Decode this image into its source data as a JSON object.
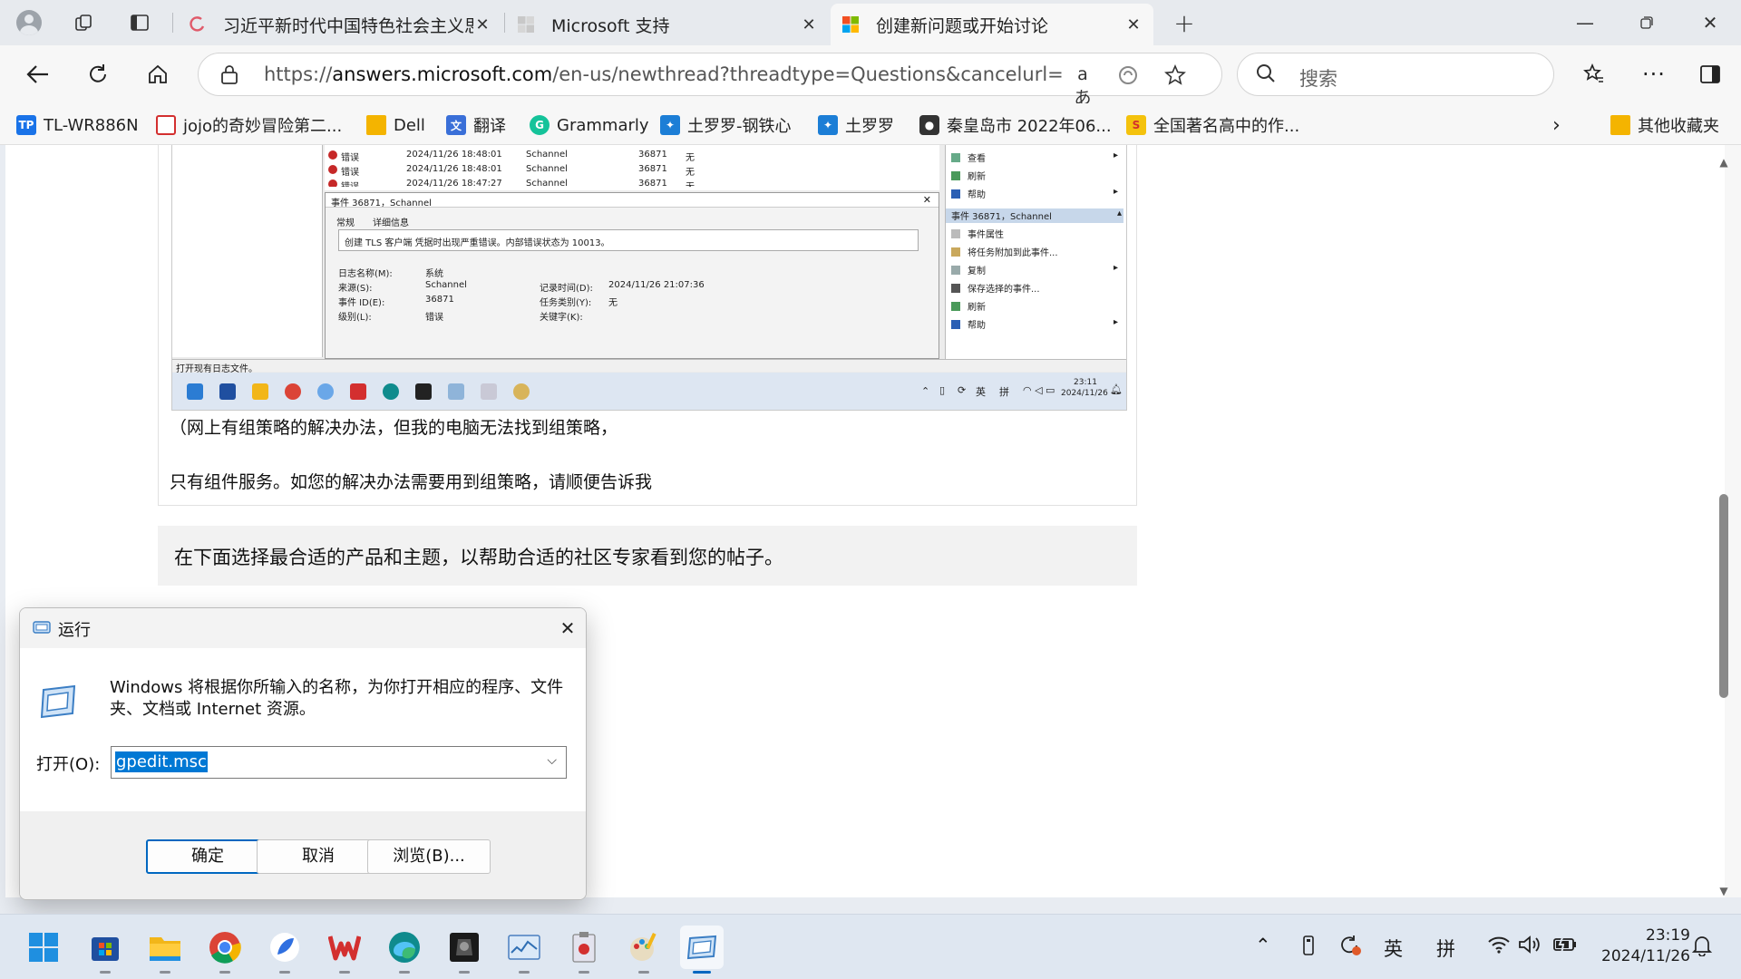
{
  "browser": {
    "tabs": [
      {
        "title": "习近平新时代中国特色社会主义思",
        "favicon": "spiral-icon",
        "active": false
      },
      {
        "title": "Microsoft 支持",
        "favicon": "microsoft-logo-icon",
        "active": false
      },
      {
        "title": "创建新问题或开始讨论",
        "favicon": "microsoft-logo-icon",
        "active": true
      }
    ],
    "url_prefix": "https://",
    "url_host": "answers.microsoft.com",
    "url_rest": "/en-us/newthread?threadtype=Questions&cancelurl=https%...",
    "read_aloud_label": "aあ",
    "search_placeholder": "搜索",
    "favorites": [
      {
        "label": "TL-WR886N",
        "icon": "tplink-icon",
        "icon_text": "TP",
        "color": "#1a73e8"
      },
      {
        "label": "jojo的奇妙冒险第二...",
        "icon": "bookmark-icon",
        "icon_text": "",
        "color": "#d32f2f"
      },
      {
        "label": "Dell",
        "icon": "folder-icon",
        "icon_text": "",
        "color": "#f4b400"
      },
      {
        "label": "翻译",
        "icon": "translate-icon",
        "icon_text": "",
        "color": "#3a6fd8"
      },
      {
        "label": "Grammarly",
        "icon": "grammarly-icon",
        "icon_text": "G",
        "color": "#15c39a"
      },
      {
        "label": "土罗罗-钢铁心",
        "icon": "game-icon",
        "icon_text": "",
        "color": "#1c7ed6"
      },
      {
        "label": "土罗罗",
        "icon": "game-icon",
        "icon_text": "",
        "color": "#1c7ed6"
      },
      {
        "label": "秦皇岛市 2022年06...",
        "icon": "video-icon",
        "icon_text": "",
        "color": "#333333"
      },
      {
        "label": "全国著名高中的作...",
        "icon": "s-logo-icon",
        "icon_text": "S",
        "color": "#f4c20d"
      }
    ],
    "other_favorites": "其他收藏夹"
  },
  "post": {
    "line1": "（网上有组策略的解决办法，但我的电脑无法找到组策略，",
    "line2": "只有组件服务。如您的解决办法需要用到组策略，请顺便告诉我",
    "hint": "在下面选择最合适的产品和主题，以帮助合适的社区专家看到您的帖子。"
  },
  "embedded_screenshot": {
    "rows": [
      {
        "level": "错误",
        "time": "2024/11/26 18:48:01",
        "source": "Schannel",
        "id": "36871",
        "task": "无"
      },
      {
        "level": "错误",
        "time": "2024/11/26 18:48:01",
        "source": "Schannel",
        "id": "36871",
        "task": "无"
      },
      {
        "level": "错误",
        "time": "2024/11/26 18:47:27",
        "source": "Schannel",
        "id": "36871",
        "task": "无"
      }
    ],
    "detail_title": "事件 36871，Schannel",
    "detail_tabs": [
      "常规",
      "详细信息"
    ],
    "message": "创建 TLS 客户端 凭据时出现严重错误。内部错误状态为 10013。",
    "fields": {
      "log_name_label": "日志名称(M):",
      "log_name": "系统",
      "source_label": "来源(S):",
      "source": "Schannel",
      "logged_label": "记录时间(D):",
      "logged": "2024/11/26 21:07:36",
      "event_id_label": "事件 ID(E):",
      "event_id": "36871",
      "task_label": "任务类别(Y):",
      "task": "无",
      "level_label": "级别(L):",
      "level": "错误",
      "keywords_label": "关键字(K):"
    },
    "actions_top": [
      {
        "label": "查看",
        "arrow": "▸"
      },
      {
        "label": "刷新",
        "arrow": ""
      },
      {
        "label": "帮助",
        "arrow": "▸"
      }
    ],
    "actions_section": "事件 36871，Schannel",
    "actions": [
      {
        "label": "事件属性",
        "arrow": ""
      },
      {
        "label": "将任务附加到此事件...",
        "arrow": ""
      },
      {
        "label": "复制",
        "arrow": "▸"
      },
      {
        "label": "保存选择的事件...",
        "arrow": ""
      },
      {
        "label": "刷新",
        "arrow": ""
      },
      {
        "label": "帮助",
        "arrow": "▸"
      }
    ],
    "status": "打开现有日志文件。",
    "tray_ime": [
      "英",
      "拼"
    ],
    "time": "23:11",
    "date": "2024/11/26"
  },
  "run_dialog": {
    "title": "运行",
    "description": "Windows 将根据你所输入的名称，为你打开相应的程序、文件夹、文档或 Internet 资源。",
    "open_label": "打开(O):",
    "input_value": "gpedit.msc",
    "ok": "确定",
    "cancel": "取消",
    "browse": "浏览(B)..."
  },
  "taskbar": {
    "apps": [
      "start-icon",
      "store-icon",
      "file-explorer-icon",
      "chrome-icon",
      "feather-app-icon",
      "wps-icon",
      "edge-icon",
      "game-app-icon",
      "system-monitor-icon",
      "task-app-icon",
      "paint-app-icon",
      "run-app-icon"
    ],
    "ime_lang": "英",
    "ime_mode": "拼",
    "time": "23:19",
    "date": "2024/11/26"
  }
}
